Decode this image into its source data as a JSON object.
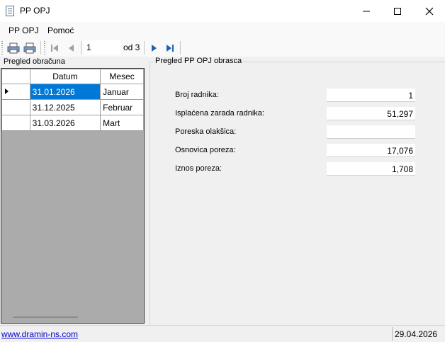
{
  "window": {
    "title": "PP OPJ"
  },
  "menu": [
    {
      "label": "PP OPJ"
    },
    {
      "label": "Pomoć"
    }
  ],
  "toolbar": {
    "page_value": "1",
    "page_of": "od 3"
  },
  "left_panel": {
    "header": "Pregled obračuna",
    "columns": [
      "Datum",
      "Mesec"
    ],
    "rows": [
      {
        "datum": "31.01.2026",
        "mesec": "Januar",
        "selected": true
      },
      {
        "datum": "31.12.2025",
        "mesec": "Februar",
        "selected": false
      },
      {
        "datum": "31.03.2026",
        "mesec": "Mart",
        "selected": false
      }
    ]
  },
  "form": {
    "title": "Pregled PP OPJ obrasca",
    "fields": [
      {
        "label": "Broj radnika:",
        "value": "1"
      },
      {
        "label": "Isplaćena zarada radnika:",
        "value": "51,297"
      },
      {
        "label": "Poreska olakšica:",
        "value": ""
      },
      {
        "label": "Osnovica poreza:",
        "value": "17,076"
      },
      {
        "label": "Iznos poreza:",
        "value": "1,708"
      }
    ]
  },
  "status": {
    "link": "www.dramin-ns.com",
    "date": "29.04.2026"
  },
  "colors": {
    "selection": "#0078d7",
    "grid_background": "#ababab",
    "link": "#0000cc"
  }
}
